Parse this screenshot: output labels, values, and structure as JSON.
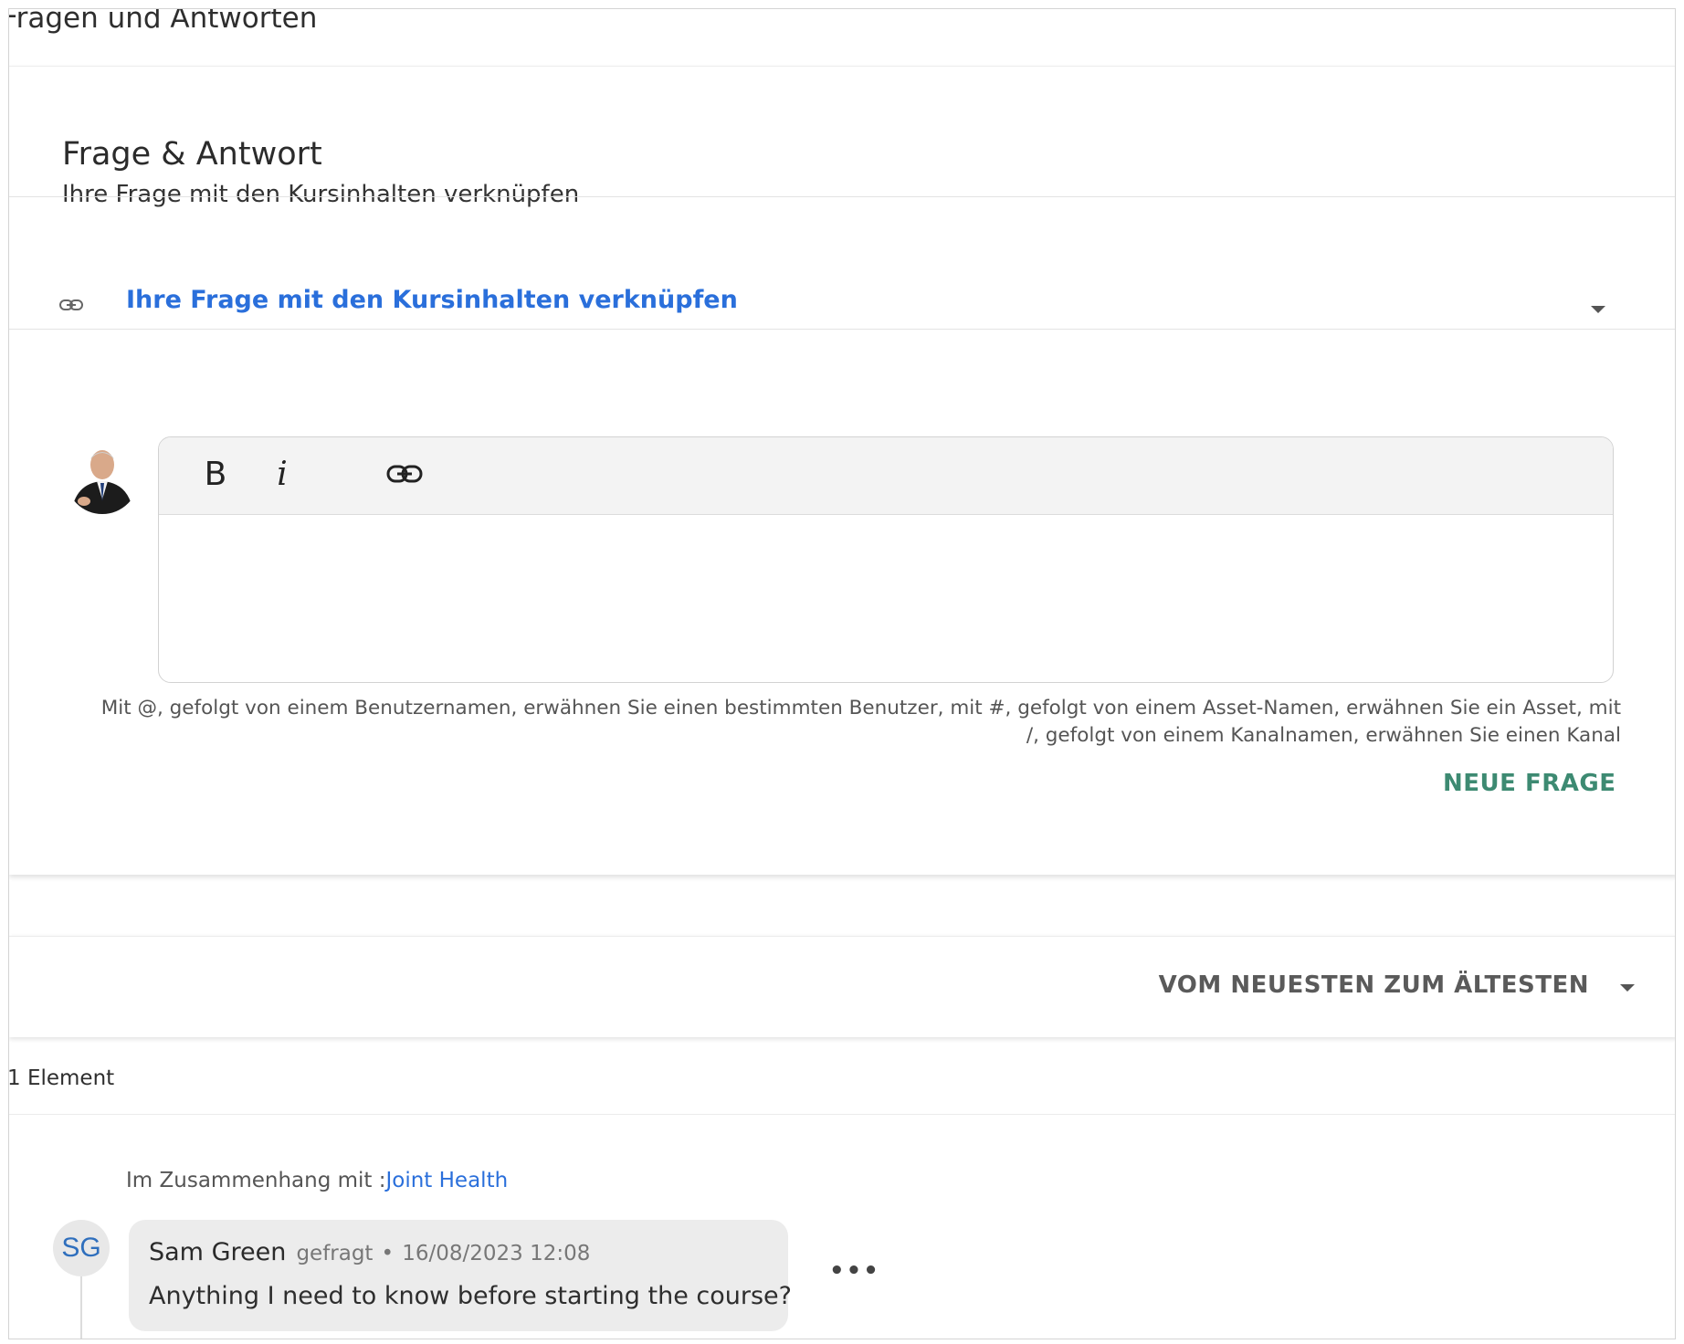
{
  "page": {
    "title": "Fragen und Antworten"
  },
  "qa": {
    "title": "Frage & Antwort",
    "subtitle": "Ihre Frage mit den Kursinhalten verknüpfen",
    "link_dropdown_label": "Ihre Frage mit den Kursinhalten verknüpfen"
  },
  "editor": {
    "bold_label": "B",
    "italic_label": "i",
    "text_value": "",
    "hint": "Mit @, gefolgt von einem Benutzernamen, erwähnen Sie einen bestimmten Benutzer, mit #, gefolgt von einem Asset-Namen, erwähnen Sie ein Asset, mit /, gefolgt von einem Kanalnamen, erwähnen Sie einen Kanal",
    "submit_label": "NEUE FRAGE"
  },
  "sort": {
    "label": "VOM NEUESTEN ZUM ÄLTESTEN"
  },
  "list": {
    "count_label": "1 Element",
    "items": [
      {
        "context_prefix": "Im Zusammenhang mit :",
        "context_link": "Joint Health",
        "initials": "SG",
        "author": "Sam Green",
        "action": "gefragt",
        "separator": "•",
        "date": "16/08/2023 12:08",
        "text": "Anything I need to know before starting the course?",
        "more_label": "•••"
      }
    ]
  },
  "colors": {
    "accent_blue": "#2a6fdb",
    "submit_green": "#3d8a72",
    "avatar_initials": "#2f6fbd"
  },
  "icons": [
    "link-icon",
    "chevron-down-icon",
    "bold-icon",
    "italic-icon",
    "more-icon"
  ]
}
